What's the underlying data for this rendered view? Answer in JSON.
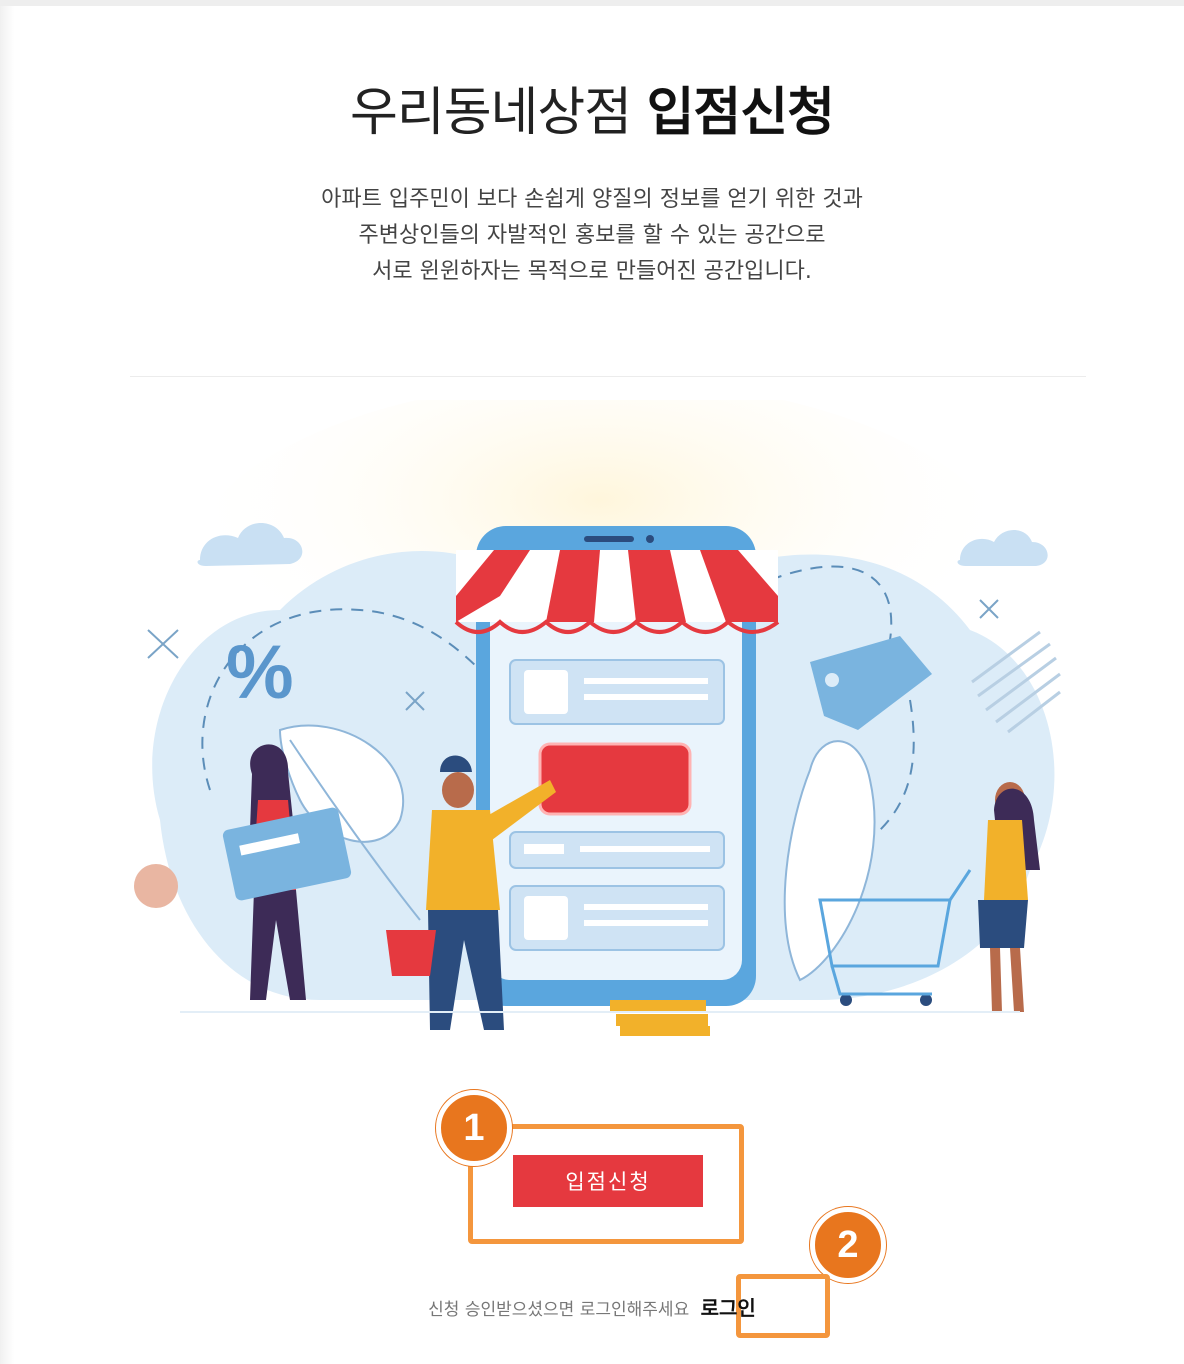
{
  "page": {
    "title_light": "우리동네상점",
    "title_bold": "입점신청",
    "description_lines": [
      "아파트 입주민이 보다 손쉽게 양질의 정보를 얻기 위한 것과",
      "주변상인들의 자발적인 홍보를 할 수 있는 공간으로",
      "서로 윈윈하자는 목적으로 만들어진 공간입니다."
    ]
  },
  "illustration": {
    "percent_text": "%"
  },
  "actions": {
    "apply_label": "입점신청",
    "login_prompt": "신청 승인받으셨으면 로그인해주세요",
    "login_label": "로그인"
  },
  "annotations": {
    "marker_1": "1",
    "marker_2": "2"
  },
  "colors": {
    "accent_red": "#e5393f",
    "annotation_orange": "#f4963d",
    "marker_orange": "#e8761e",
    "illustration_blue": "#5aa6de",
    "illustration_light_blue": "#dcecf8",
    "illustration_yellow": "#f2b12a"
  }
}
